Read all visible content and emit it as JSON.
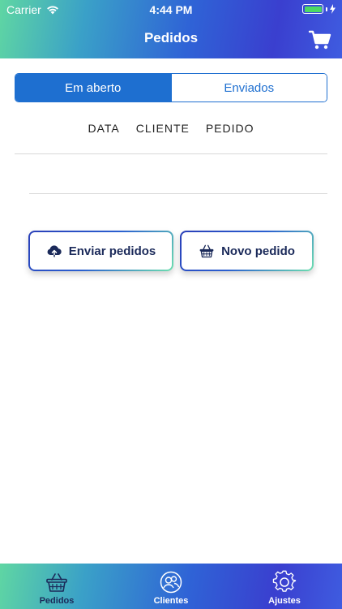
{
  "status_bar": {
    "carrier": "Carrier",
    "time": "4:44 PM"
  },
  "header": {
    "title": "Pedidos",
    "cart_icon": "cart-icon"
  },
  "segmented": {
    "open_label": "Em aberto",
    "sent_label": "Enviados",
    "selected": "Em aberto"
  },
  "table": {
    "columns": [
      "DATA",
      "CLIENTE",
      "PEDIDO"
    ]
  },
  "actions": {
    "send_label": "Enviar pedidos",
    "new_label": "Novo pedido"
  },
  "tabbar": {
    "items": [
      {
        "label": "Pedidos",
        "icon": "basket-icon",
        "active": true
      },
      {
        "label": "Clientes",
        "icon": "clients-icon",
        "active": false
      },
      {
        "label": "Ajustes",
        "icon": "settings-icon",
        "active": false
      }
    ]
  },
  "colors": {
    "accent": "#1e6fd0",
    "navy": "#1b2a5a",
    "gradient_start": "#5fd6a3",
    "gradient_end": "#3f5ce0",
    "battery": "#4cd964"
  }
}
